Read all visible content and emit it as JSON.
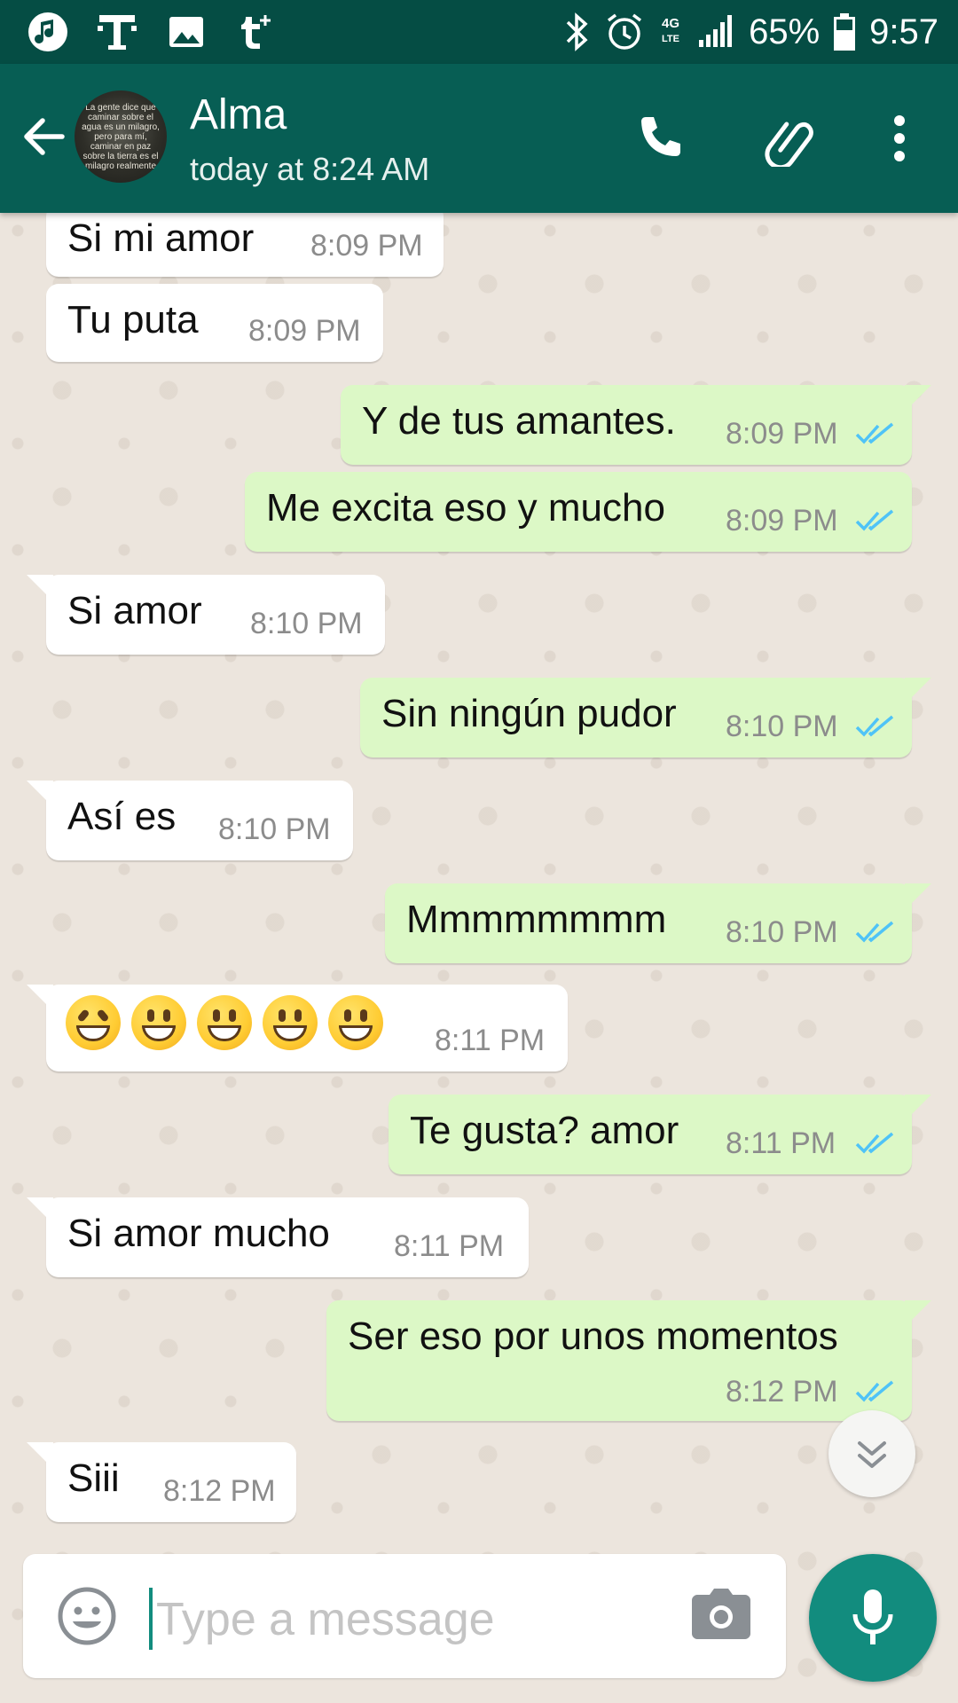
{
  "status_bar": {
    "battery": "65%",
    "time": "9:57",
    "network": "4G LTE",
    "left_icons": [
      "music-notification-icon",
      "t-mobile-icon",
      "image-icon",
      "tumblr-icon"
    ],
    "right_icons": [
      "bluetooth-icon",
      "alarm-icon",
      "signal-icon",
      "battery-icon"
    ]
  },
  "header": {
    "contact_name": "Alma",
    "last_seen": "today at 8:24 AM",
    "avatar_text": "La gente dice que caminar sobre el agua es un milagro, pero para mí, caminar en paz sobre la tierra es el milagro realmente"
  },
  "messages": [
    {
      "dir": "in",
      "text": "Si mi amor",
      "time": "8:09 PM"
    },
    {
      "dir": "in",
      "text": "Tu puta",
      "time": "8:09 PM"
    },
    {
      "dir": "out",
      "text": "Y de tus amantes.",
      "time": "8:09 PM"
    },
    {
      "dir": "out",
      "text": "Me excita eso y mucho",
      "time": "8:09 PM"
    },
    {
      "dir": "in",
      "text": "Si amor",
      "time": "8:10 PM"
    },
    {
      "dir": "out",
      "text": "Sin ningún pudor",
      "time": "8:10 PM"
    },
    {
      "dir": "in",
      "text": "Así es",
      "time": "8:10 PM"
    },
    {
      "dir": "out",
      "text": "Mmmmmmmm",
      "time": "8:10 PM"
    },
    {
      "dir": "in",
      "text": "😆😁😁😃😀",
      "time": "8:11 PM"
    },
    {
      "dir": "out",
      "text": "Te gusta? amor",
      "time": "8:11 PM"
    },
    {
      "dir": "in",
      "text": "Si amor mucho",
      "time": "8:11 PM"
    },
    {
      "dir": "out",
      "text": "Ser eso por unos momentos",
      "time": "8:12 PM"
    },
    {
      "dir": "in",
      "text": "Siii",
      "time": "8:12 PM"
    }
  ],
  "input": {
    "placeholder": "Type a message"
  },
  "colors": {
    "header": "#075e54",
    "status_bar": "#054d44",
    "outgoing_bubble": "#dcf8c6",
    "incoming_bubble": "#ffffff",
    "accent": "#128c7e",
    "read_ticks": "#4fc3f7"
  }
}
